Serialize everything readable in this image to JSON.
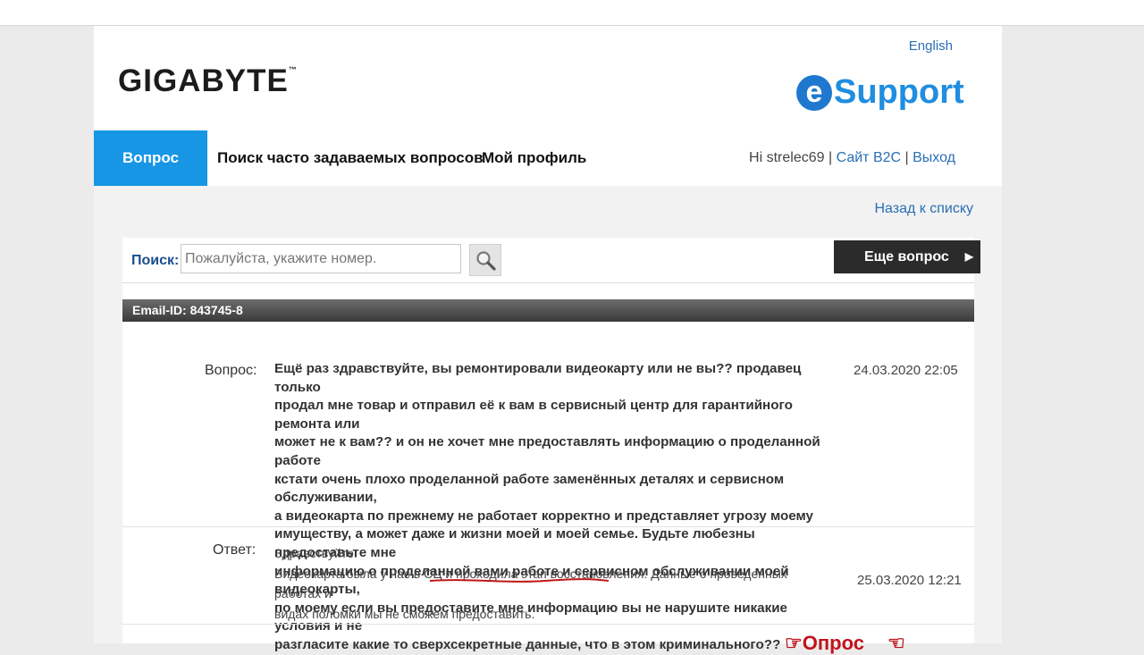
{
  "header": {
    "logo": "GIGABYTE",
    "logo_tm": "™",
    "language_link": "English",
    "esupport_e": "e",
    "esupport_word": "Support"
  },
  "nav": {
    "tabs": [
      {
        "label": "Вопрос",
        "active": true
      },
      {
        "label": "Поиск часто задаваемых вопросов",
        "active": false
      },
      {
        "label": "Мой профиль",
        "active": false
      }
    ],
    "greeting": "Hi strelec69",
    "separator": "|",
    "site_link": "Сайт B2C",
    "logout_link": "Выход"
  },
  "back_link": "Назад к списку",
  "search": {
    "label": "Поиск:",
    "placeholder": "Пожалуйста, укажите номер."
  },
  "more_button": "Еще вопрос",
  "email_id": "Email-ID: 843745-8",
  "question": {
    "label": "Вопрос:",
    "lines": [
      "Ещё раз здравствуйте, вы ремонтировали видеокарту или не вы?? продавец только",
      "продал мне товар и отправил её к вам в сервисный центр для гарантийного ремонта или",
      "может не к вам?? и он не хочет мне предоставлять информацию о проделанной работе",
      "кстати очень плохо проделанной работе заменённых деталях и сервисном обслуживании,",
      "а видеокарта по прежнему не работает корректно и представляет угрозу моему",
      "имуществу, а может даже и жизни моей и моей семье. Будьте любезны предоставьте мне",
      "информацию о проделанной вами работе и сервисном обслуживании моей видеокарты,",
      "по моему если вы предоставите мне информацию вы не нарушите никакие условия и не",
      "разгласите какие то сверхсекретные данные, что в этом криминального??"
    ],
    "date": "24.03.2020 22:05"
  },
  "answer": {
    "label": "Ответ:",
    "lines": [
      "Здравствуйте.",
      "Видеокарта была у нас в СЦ и проходила этап восстановления. Данные о проведенных работах и",
      "видах поломки мы не сможем предоставить."
    ],
    "date": "25.03.2020 12:21"
  },
  "poll": {
    "label": "Опрос",
    "icon_left": "thumbs-up-icon",
    "icon_right": "thumbs-down-icon"
  },
  "colors": {
    "accent_blue": "#1696e4",
    "link_blue": "#2a6fb3",
    "poll_red": "#c0141c",
    "underline_red": "#c01818"
  }
}
